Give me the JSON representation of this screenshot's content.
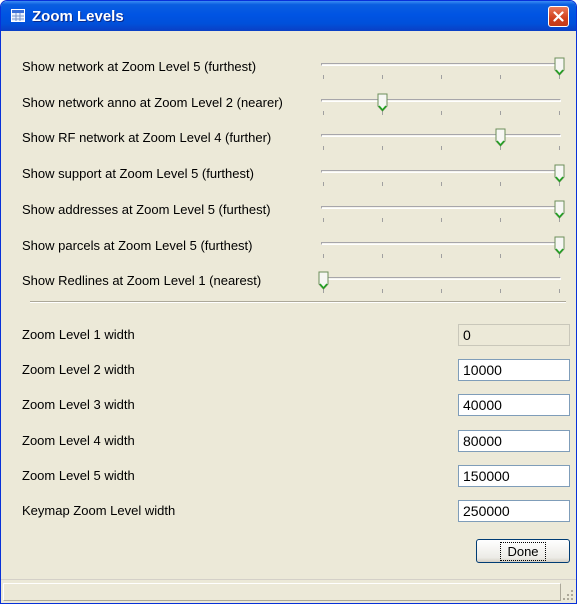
{
  "window": {
    "title": "Zoom Levels",
    "icon": "grid-window-icon"
  },
  "sliders": [
    {
      "label": "Show network at Zoom Level 5 (furthest)",
      "level": 5
    },
    {
      "label": "Show network anno at Zoom Level 2 (nearer)",
      "level": 2
    },
    {
      "label": "Show RF network at Zoom Level 4 (further)",
      "level": 4
    },
    {
      "label": "Show support at Zoom Level 5 (furthest)",
      "level": 5
    },
    {
      "label": "Show addresses at Zoom Level 5 (furthest)",
      "level": 5
    },
    {
      "label": "Show parcels at Zoom Level 5 (furthest)",
      "level": 5
    },
    {
      "label": "Show Redlines at Zoom Level 1 (nearest)",
      "level": 1
    }
  ],
  "slider_range": {
    "min": 1,
    "max": 5
  },
  "widths": [
    {
      "label": "Zoom Level 1 width",
      "value": "0",
      "enabled": false
    },
    {
      "label": "Zoom Level 2 width",
      "value": "10000",
      "enabled": true
    },
    {
      "label": "Zoom Level 3 width",
      "value": "40000",
      "enabled": true
    },
    {
      "label": "Zoom Level 4 width",
      "value": "80000",
      "enabled": true
    },
    {
      "label": "Zoom Level 5 width",
      "value": "150000",
      "enabled": true
    },
    {
      "label": "Keymap Zoom Level width",
      "value": "250000",
      "enabled": true
    }
  ],
  "buttons": {
    "done": "Done"
  },
  "colors": {
    "titlebar": "#0054e3",
    "dialog_bg": "#ece9d8",
    "close": "#d1411d",
    "slider_thumb_accent": "#21a121"
  }
}
